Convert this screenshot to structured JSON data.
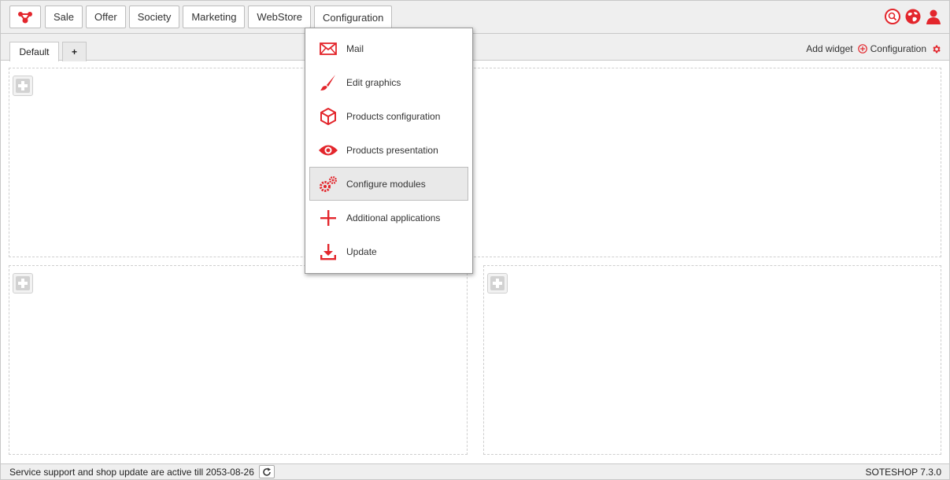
{
  "nav": {
    "items": [
      {
        "label": "Sale"
      },
      {
        "label": "Offer"
      },
      {
        "label": "Society"
      },
      {
        "label": "Marketing"
      },
      {
        "label": "WebStore"
      },
      {
        "label": "Configuration"
      }
    ],
    "active": "Configuration"
  },
  "top_icons": [
    "search-icon",
    "globe-icon",
    "user-icon"
  ],
  "tabs": {
    "default_label": "Default",
    "add_label": "+"
  },
  "toolbar": {
    "add_widget_label": "Add widget",
    "configuration_label": "Configuration"
  },
  "dropdown": {
    "items": [
      {
        "label": "Mail",
        "icon": "envelope-icon"
      },
      {
        "label": "Edit graphics",
        "icon": "brush-icon"
      },
      {
        "label": "Products configuration",
        "icon": "box-icon"
      },
      {
        "label": "Products presentation",
        "icon": "eye-icon"
      },
      {
        "label": "Configure modules",
        "icon": "gears-icon"
      },
      {
        "label": "Additional applications",
        "icon": "plus-icon"
      },
      {
        "label": "Update",
        "icon": "download-icon"
      }
    ],
    "hovered": "Configure modules"
  },
  "status": {
    "text": "Service support and shop update are active till 2053-08-26",
    "version": "SOTESHOP 7.3.0"
  },
  "colors": {
    "accent": "#e3262c",
    "panel_border": "#cfcfcf",
    "bar_bg": "#efefef"
  }
}
